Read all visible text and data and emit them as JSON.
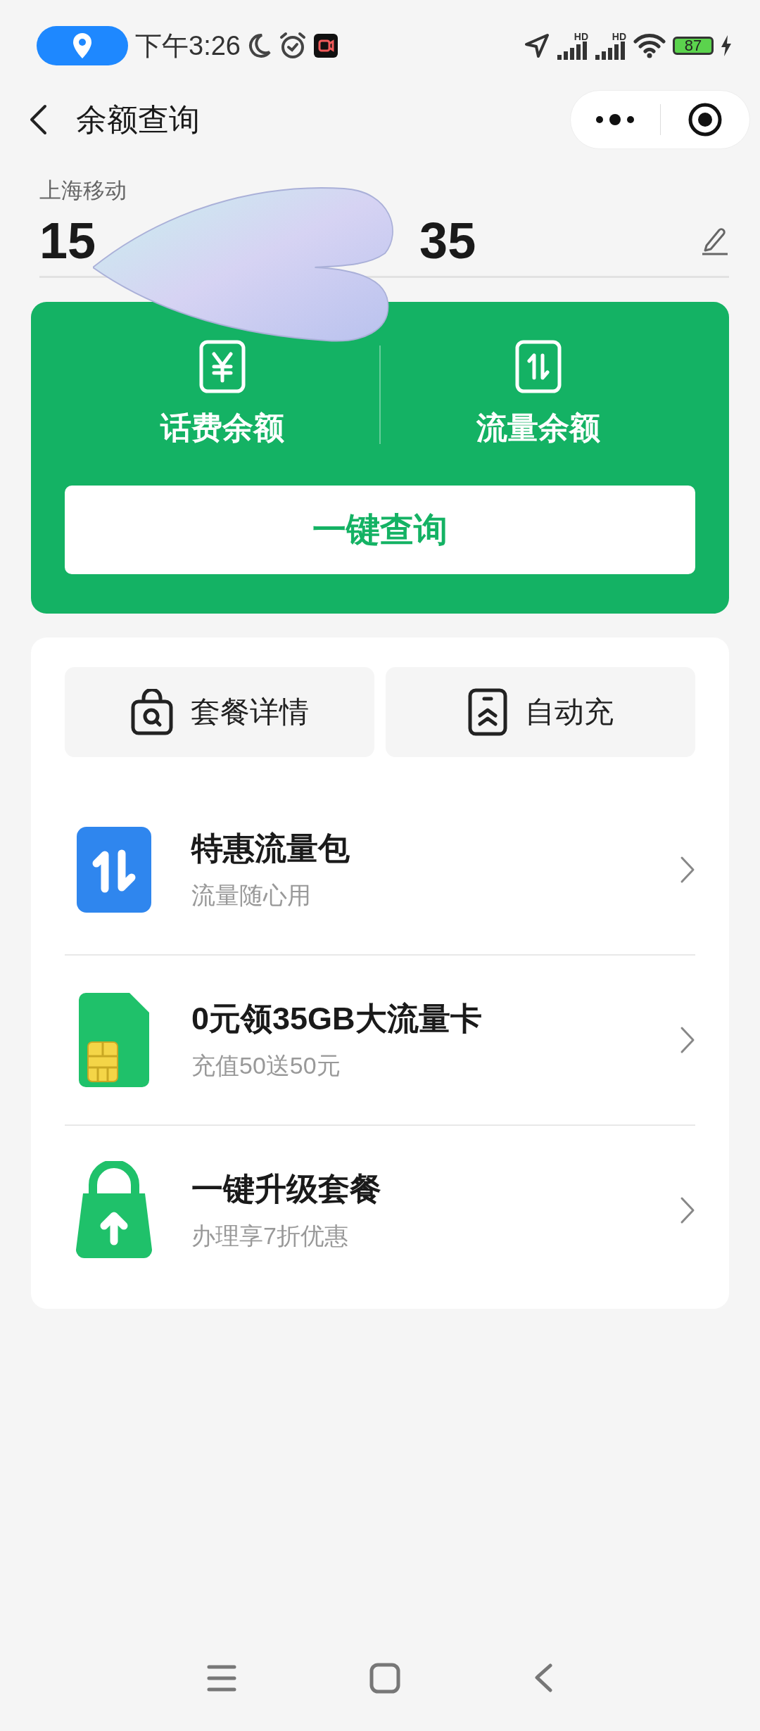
{
  "status_bar": {
    "time": "下午3:26",
    "signal_labels": [
      "HD",
      "HD"
    ],
    "battery": "87"
  },
  "header": {
    "title": "余额查询"
  },
  "account": {
    "carrier": "上海移动",
    "number_start": "15",
    "number_end": "35"
  },
  "balance_card": {
    "items": [
      {
        "kind": "yuan",
        "label": "话费余额"
      },
      {
        "kind": "data",
        "label": "流量余额"
      }
    ],
    "button": "一键查询"
  },
  "quick_actions": [
    {
      "kind": "bag",
      "label": "套餐详情"
    },
    {
      "kind": "auto",
      "label": "自动充"
    }
  ],
  "offers": [
    {
      "kind": "data",
      "title": "特惠流量包",
      "subtitle": "流量随心用"
    },
    {
      "kind": "sim",
      "title": "0元领35GB大流量卡",
      "subtitle": "充值50送50元"
    },
    {
      "kind": "upgrade",
      "title": "一键升级套餐",
      "subtitle": "办理享7折优惠"
    }
  ]
}
